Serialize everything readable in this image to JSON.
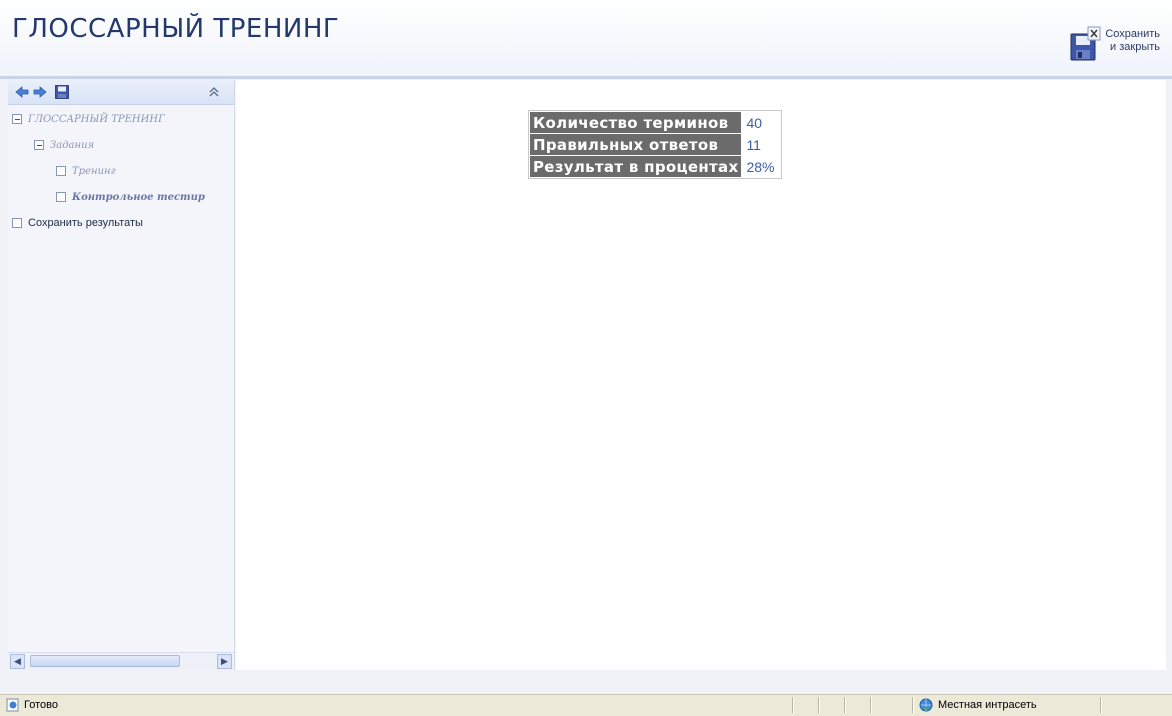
{
  "header": {
    "title": "ГЛОССАРНЫЙ ТРЕНИНГ",
    "save_close_line1": "Сохранить",
    "save_close_line2": "и закрыть",
    "save_close_icon": "floppy-disk-close-icon"
  },
  "nav_toolbar": {
    "back_icon": "arrow-left-icon",
    "forward_icon": "arrow-right-icon",
    "save_icon": "floppy-disk-icon",
    "collapse_icon": "double-chevron-up-icon"
  },
  "tree": {
    "items": [
      {
        "label": "ГЛОССАРНЫЙ ТРЕНИНГ",
        "expander": "minus"
      },
      {
        "label": "Задания",
        "expander": "minus"
      },
      {
        "label": "Тренинг",
        "expander": "box"
      },
      {
        "label": "Контрольное тестир",
        "expander": "box"
      },
      {
        "label": "Сохранить результаты",
        "expander": "box"
      }
    ]
  },
  "results": {
    "rows": [
      {
        "label": "Количество терминов",
        "value": "40"
      },
      {
        "label": "Правильных ответов",
        "value": "11"
      },
      {
        "label": "Результат в процентах",
        "value": "28%"
      }
    ]
  },
  "status_bar": {
    "status_text": "Готово",
    "zone_text": "Местная интрасеть"
  },
  "colors": {
    "accent": "#23396b",
    "label_bg": "#6b6b6b",
    "value_text": "#3b5f9e"
  }
}
